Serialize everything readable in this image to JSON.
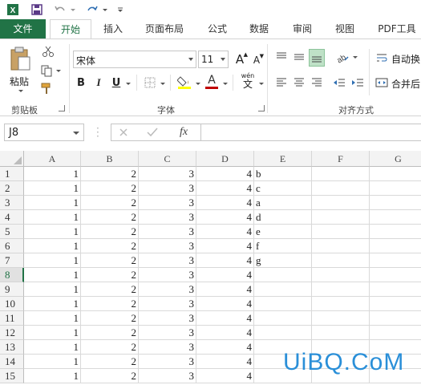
{
  "tabs": [
    {
      "label": "文件"
    },
    {
      "label": "开始"
    },
    {
      "label": "插入"
    },
    {
      "label": "页面布局"
    },
    {
      "label": "公式"
    },
    {
      "label": "数据"
    },
    {
      "label": "审阅"
    },
    {
      "label": "视图"
    },
    {
      "label": "PDF工具"
    }
  ],
  "ribbon": {
    "paste_label": "粘贴",
    "font_name": "宋体",
    "font_size": "11",
    "wrap_label": "自动换",
    "merge_label": "合并后",
    "group_clipboard": "剪贴板",
    "group_font": "字体",
    "group_align": "对齐方式",
    "bold": "B",
    "italic": "I",
    "underline": "U",
    "font_color_glyph": "A",
    "grow_font": "A",
    "shrink_font": "A",
    "phonetic": "wén"
  },
  "formula_bar": {
    "name_box": "J8",
    "fx": "fx",
    "value": ""
  },
  "columns": [
    "A",
    "B",
    "C",
    "D",
    "E",
    "F",
    "G"
  ],
  "rows": [
    {
      "num": "1",
      "a": "1",
      "b": "2",
      "c": "3",
      "d": "4",
      "e": "b"
    },
    {
      "num": "2",
      "a": "1",
      "b": "2",
      "c": "3",
      "d": "4",
      "e": "c"
    },
    {
      "num": "3",
      "a": "1",
      "b": "2",
      "c": "3",
      "d": "4",
      "e": "a"
    },
    {
      "num": "4",
      "a": "1",
      "b": "2",
      "c": "3",
      "d": "4",
      "e": "d"
    },
    {
      "num": "5",
      "a": "1",
      "b": "2",
      "c": "3",
      "d": "4",
      "e": "e"
    },
    {
      "num": "6",
      "a": "1",
      "b": "2",
      "c": "3",
      "d": "4",
      "e": "f"
    },
    {
      "num": "7",
      "a": "1",
      "b": "2",
      "c": "3",
      "d": "4",
      "e": "g"
    },
    {
      "num": "8",
      "a": "1",
      "b": "2",
      "c": "3",
      "d": "4",
      "e": ""
    },
    {
      "num": "9",
      "a": "1",
      "b": "2",
      "c": "3",
      "d": "4",
      "e": ""
    },
    {
      "num": "10",
      "a": "1",
      "b": "2",
      "c": "3",
      "d": "4",
      "e": ""
    },
    {
      "num": "11",
      "a": "1",
      "b": "2",
      "c": "3",
      "d": "4",
      "e": ""
    },
    {
      "num": "12",
      "a": "1",
      "b": "2",
      "c": "3",
      "d": "4",
      "e": ""
    },
    {
      "num": "13",
      "a": "1",
      "b": "2",
      "c": "3",
      "d": "4",
      "e": ""
    },
    {
      "num": "14",
      "a": "1",
      "b": "2",
      "c": "3",
      "d": "4",
      "e": ""
    },
    {
      "num": "15",
      "a": "1",
      "b": "2",
      "c": "3",
      "d": "4",
      "e": ""
    }
  ],
  "selected_row": "8",
  "watermark": "UiBQ.CoM",
  "colors": {
    "accent": "#217346",
    "highlight": "#ffff00",
    "font_color": "#c00000",
    "watermark": "#2a8fd8"
  }
}
